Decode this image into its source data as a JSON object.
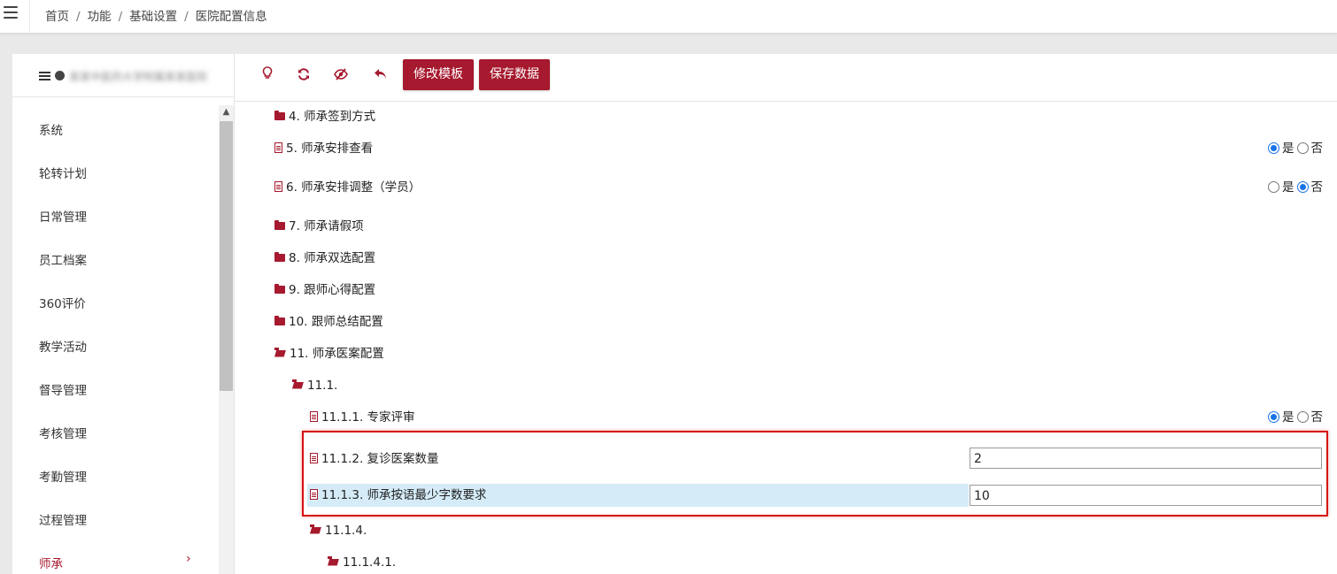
{
  "breadcrumb": [
    "首页",
    "功能",
    "基础设置",
    "医院配置信息"
  ],
  "breadcrumb_sep": "/",
  "sidebar": {
    "org_name": "某某中医药大学附属某某医院",
    "items": [
      {
        "label": "系统"
      },
      {
        "label": "轮转计划"
      },
      {
        "label": "日常管理"
      },
      {
        "label": "员工档案"
      },
      {
        "label": "360评价"
      },
      {
        "label": "教学活动"
      },
      {
        "label": "督导管理"
      },
      {
        "label": "考核管理"
      },
      {
        "label": "考勤管理"
      },
      {
        "label": "过程管理"
      },
      {
        "label": "师承",
        "active": true,
        "arrow": "›"
      }
    ]
  },
  "toolbar": {
    "icons": [
      "lightbulb-icon",
      "refresh-icon",
      "eye-slash-icon",
      "undo-icon"
    ],
    "modify_template_label": "修改模板",
    "save_data_label": "保存数据"
  },
  "tree": {
    "yes_label": "是",
    "no_label": "否",
    "nodes": [
      {
        "label": "4. 师承签到方式",
        "icon": "folder"
      },
      {
        "label": "5. 师承安排查看",
        "icon": "file",
        "control": "radio",
        "value": "是"
      },
      {
        "label": "6. 师承安排调整（学员）",
        "icon": "file",
        "control": "radio",
        "value": "否"
      },
      {
        "label": "7. 师承请假项",
        "icon": "folder"
      },
      {
        "label": "8. 师承双选配置",
        "icon": "folder"
      },
      {
        "label": "9. 跟师心得配置",
        "icon": "folder"
      },
      {
        "label": "10. 跟师总结配置",
        "icon": "folder"
      },
      {
        "label": "11. 师承医案配置",
        "icon": "folder-open"
      },
      {
        "label": "11.1.",
        "icon": "folder-open"
      },
      {
        "label": "11.1.1. 专家评审",
        "icon": "file",
        "control": "radio",
        "value": "是"
      },
      {
        "label": "11.1.2. 复诊医案数量",
        "icon": "file",
        "control": "input",
        "value": "2"
      },
      {
        "label": "11.1.3. 师承按语最少字数要求",
        "icon": "file",
        "control": "input",
        "value": "10",
        "highlighted": true
      },
      {
        "label": "11.1.4.",
        "icon": "folder-open"
      },
      {
        "label": "11.1.4.1.",
        "icon": "folder-open"
      }
    ]
  },
  "colors": {
    "accent": "#a6192e",
    "radio_selected": "#1a73e8",
    "highlight_row": "#d5ecf8",
    "annotation_box": "#d80f0f"
  }
}
